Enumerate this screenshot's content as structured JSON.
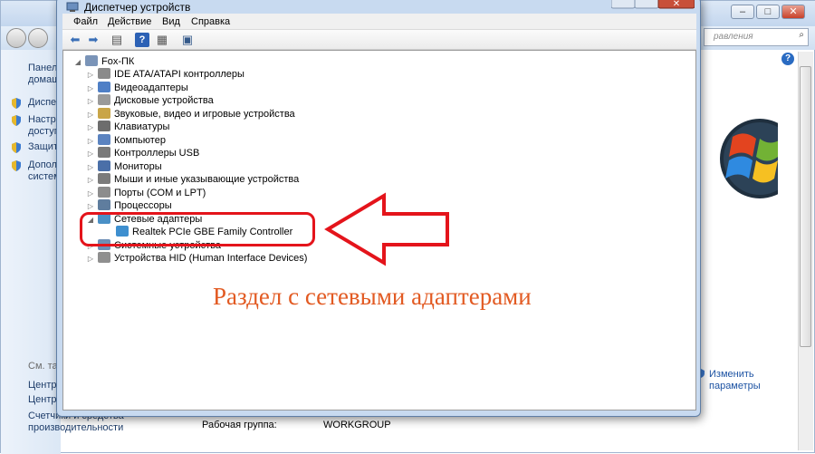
{
  "background_window": {
    "search_placeholder": "равления",
    "left_pane_items": [
      {
        "label": "Панел",
        "sublabel": "домаш"
      },
      {
        "label": "Диспе"
      },
      {
        "label": "Настро",
        "sublabel": "доступ"
      },
      {
        "label": "Защит"
      },
      {
        "label": "Допол",
        "sublabel": "систем"
      }
    ],
    "see_also_label": "См. так",
    "see_also_items": [
      "Центр",
      "Центр",
      "Счетчики и средства",
      "производительности"
    ],
    "change_link_label": "Изменить",
    "change_link_label2": "параметры",
    "workgroup_label": "Рабочая группа:",
    "workgroup_value": "WORKGROUP"
  },
  "device_manager": {
    "title": "Диспетчер устройств",
    "menu": [
      "Файл",
      "Действие",
      "Вид",
      "Справка"
    ],
    "root": "Fox-ПК",
    "categories": [
      "IDE ATA/ATAPI контроллеры",
      "Видеоадаптеры",
      "Дисковые устройства",
      "Звуковые, видео и игровые устройства",
      "Клавиатуры",
      "Компьютер",
      "Контроллеры USB",
      "Мониторы",
      "Мыши и иные указывающие устройства",
      "Порты (COM и LPT)",
      "Процессоры",
      "Сетевые адаптеры",
      "Системные устройства",
      "Устройства HID (Human Interface Devices)"
    ],
    "network_adapter": "Realtek PCIe GBE Family Controller"
  },
  "annotation": {
    "text": "Раздел с сетевыми адаптерами",
    "color": "#e25a22",
    "highlight_color": "#e4141b"
  }
}
